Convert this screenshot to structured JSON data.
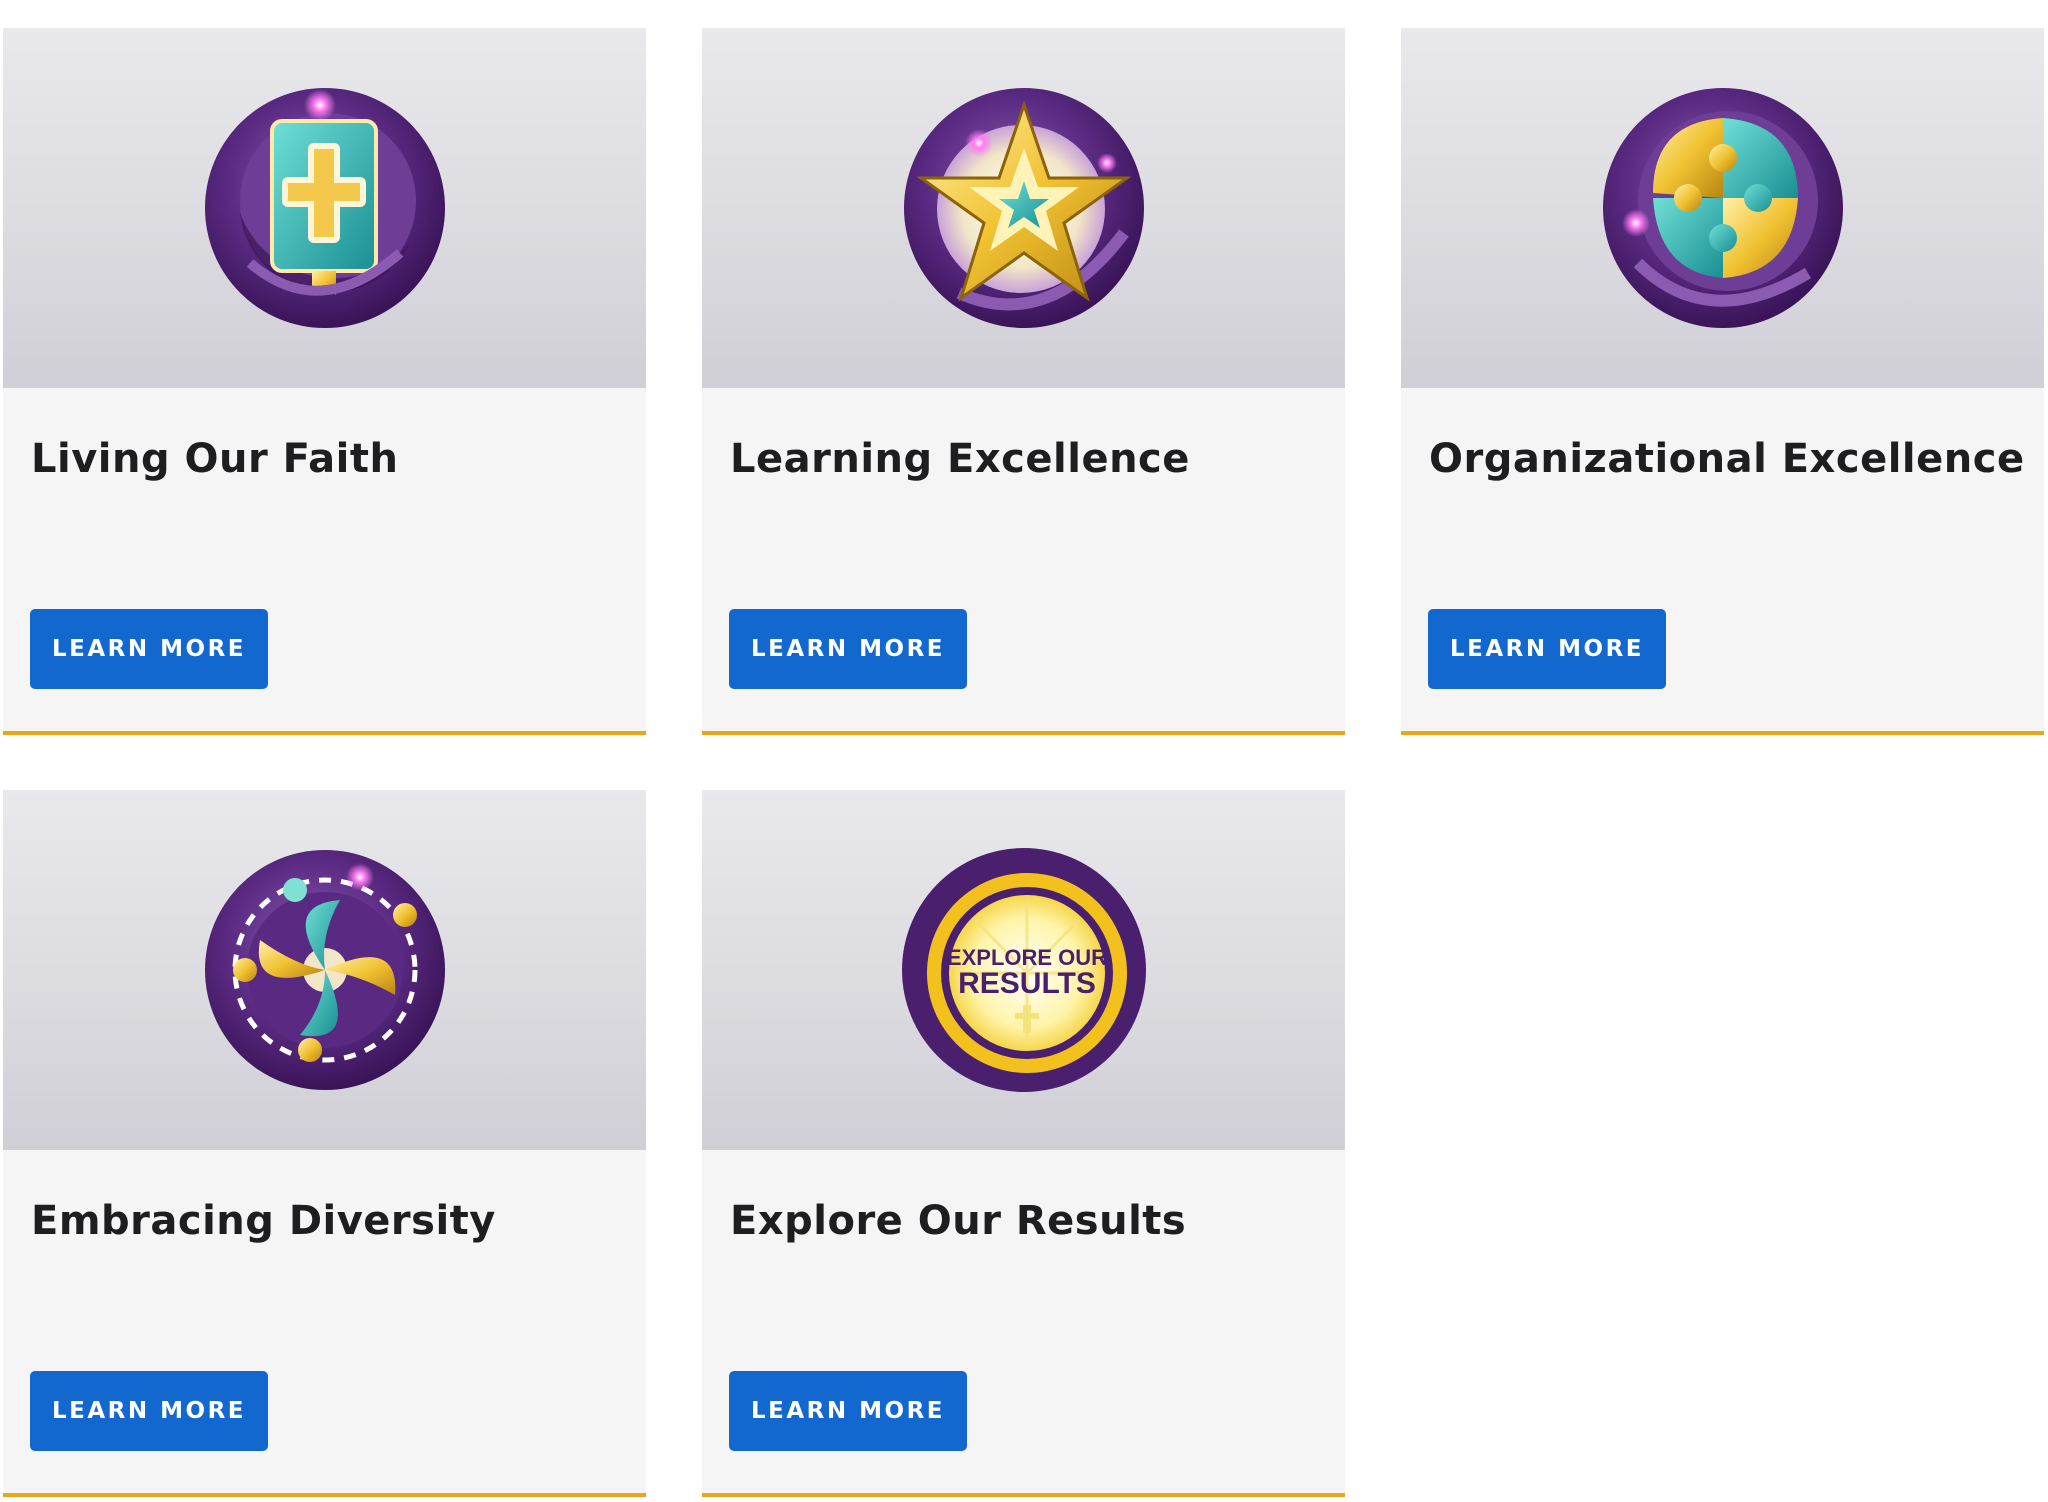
{
  "cards": [
    {
      "title": "Living Our Faith",
      "button_label": "LEARN MORE",
      "icon": "bible-cross-icon"
    },
    {
      "title": "Learning Excellence",
      "button_label": "LEARN MORE",
      "icon": "star-icon"
    },
    {
      "title": "Organizational Excellence",
      "button_label": "LEARN MORE",
      "icon": "puzzle-icon"
    },
    {
      "title": "Embracing Diversity",
      "button_label": "LEARN MORE",
      "icon": "people-circle-icon"
    },
    {
      "title": "Explore Our Results",
      "button_label": "LEARN MORE",
      "icon": "explore-results-icon",
      "badge_text_line1": "EXPLORE OUR",
      "badge_text_line2": "RESULTS"
    }
  ],
  "colors": {
    "accent_underline": "#e8a619",
    "button_blue": "#1268cf",
    "badge_purple": "#4a1f6e",
    "badge_gold": "#f2c11d",
    "badge_teal": "#2bb7b0"
  }
}
